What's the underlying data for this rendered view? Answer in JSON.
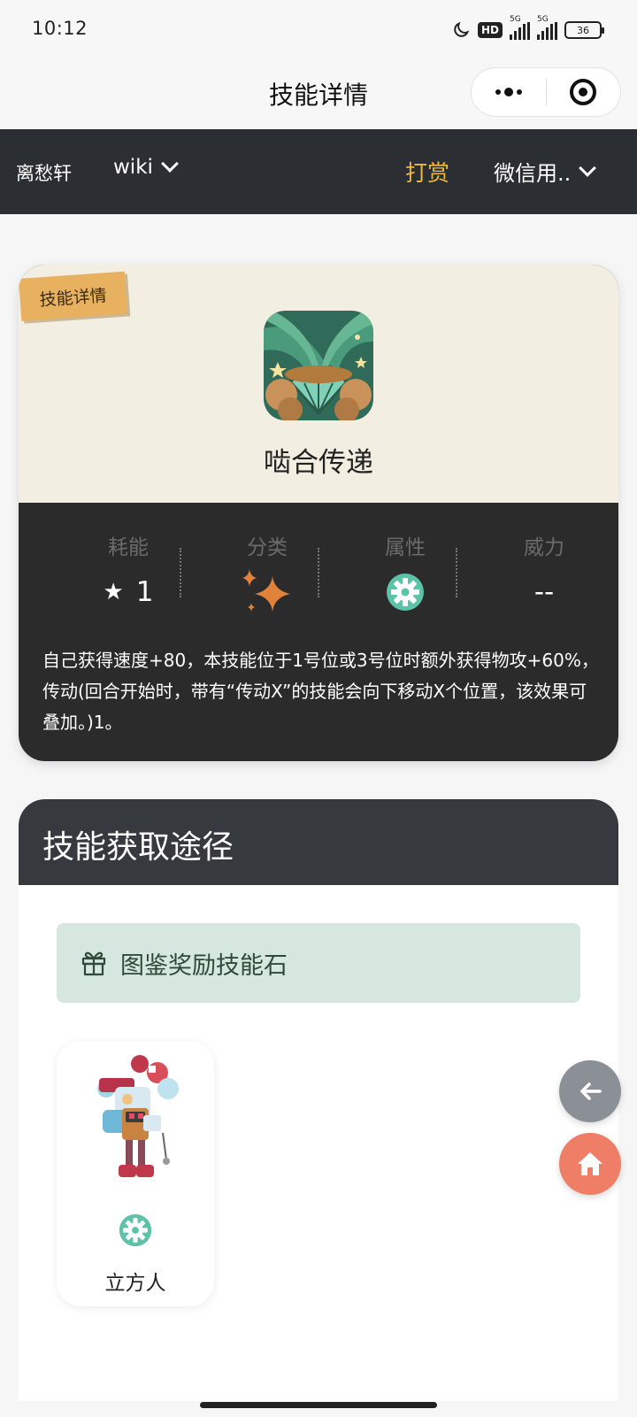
{
  "status_bar": {
    "time": "10:12",
    "network_1": "5G",
    "network_2": "5G",
    "hd_label": "HD",
    "battery": "36"
  },
  "title_bar": {
    "title": "技能详情"
  },
  "nav": {
    "brand": "离愁轩",
    "wiki_label": "wiki",
    "reward_label": "打赏",
    "user_label": "微信用..",
    "reward_color": "#f0b93a"
  },
  "skill": {
    "ribbon": "技能详情",
    "name": "啮合传递",
    "stats": [
      {
        "label": "耗能",
        "value": "1",
        "icon": "star-icon"
      },
      {
        "label": "分类",
        "value": "",
        "icon": "sparkle-icon"
      },
      {
        "label": "属性",
        "value": "",
        "icon": "gear-attribute-icon"
      },
      {
        "label": "威力",
        "value": "--",
        "icon": ""
      }
    ],
    "description": "自己获得速度+80，本技能位于1号位或3号位时额外获得物攻+60%，传动(回合开始时，带有“传动X”的技能会向下移动X个位置，该效果可叠加。)1。"
  },
  "obtain": {
    "title": "技能获取途径",
    "source_label": "图鉴奖励技能石",
    "pets": [
      {
        "name": "立方人",
        "attribute_icon": "gear-attribute-icon"
      }
    ]
  },
  "colors": {
    "nav_bg": "#2b2f33",
    "accent_orange": "#f0b93a",
    "mechanical_attr": "#5cc3a8",
    "home_button": "#ef7e66",
    "back_button": "#8a9096"
  }
}
